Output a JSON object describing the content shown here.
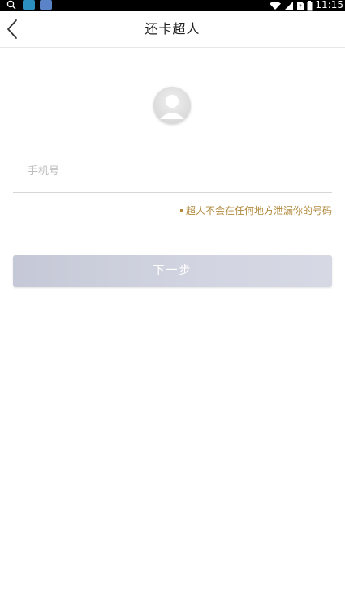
{
  "status_bar": {
    "time": "11:15",
    "icons": [
      "search-icon",
      "app-icon",
      "app-icon",
      "wifi-icon",
      "signal-icon",
      "no-sim-icon",
      "battery-icon"
    ]
  },
  "header": {
    "title": "还卡超人",
    "back_icon": "chevron-left-icon"
  },
  "avatar": {
    "icon": "user-avatar-icon"
  },
  "phone": {
    "placeholder": "手机号",
    "value": ""
  },
  "privacy_note": "超人不会在任何地方泄漏你的号码",
  "next_button": {
    "label": "下一步"
  },
  "colors": {
    "accent_note": "#b08a3e",
    "button_disabled": "#cdd0dc",
    "status_bar": "#000000"
  }
}
